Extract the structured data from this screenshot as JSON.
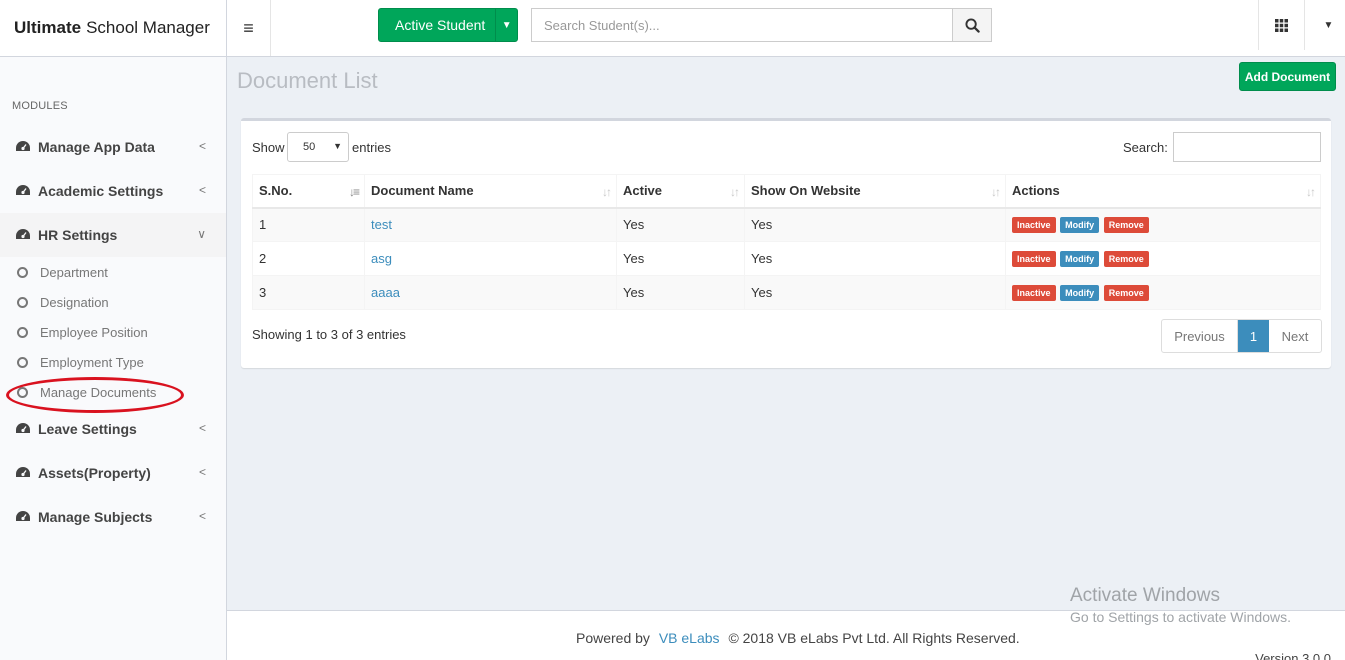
{
  "app": {
    "title_bold": "Ultimate",
    "title_rest": "School Manager"
  },
  "topbar": {
    "active_student_label": "Active Student",
    "search_placeholder": "Search Student(s)..."
  },
  "sidebar": {
    "header": "MODULES",
    "items": [
      {
        "label": "Manage App Data"
      },
      {
        "label": "Academic Settings"
      },
      {
        "label": "HR Settings"
      },
      {
        "label": "Leave Settings"
      },
      {
        "label": "Assets(Property)"
      },
      {
        "label": "Manage Subjects"
      }
    ],
    "hr_subitems": [
      {
        "label": "Department"
      },
      {
        "label": "Designation"
      },
      {
        "label": "Employee Position"
      },
      {
        "label": "Employment Type"
      },
      {
        "label": "Manage Documents"
      }
    ]
  },
  "page": {
    "title": "Document List",
    "add_button": "Add Document"
  },
  "table_controls": {
    "show": "Show",
    "entries": "entries",
    "page_size": "50",
    "search_label": "Search:"
  },
  "table": {
    "columns": [
      "S.No.",
      "Document Name",
      "Active",
      "Show On Website",
      "Actions"
    ],
    "rows": [
      {
        "sno": "1",
        "name": "test",
        "active": "Yes",
        "website": "Yes"
      },
      {
        "sno": "2",
        "name": "asg",
        "active": "Yes",
        "website": "Yes"
      },
      {
        "sno": "3",
        "name": "aaaa",
        "active": "Yes",
        "website": "Yes"
      }
    ],
    "actions": {
      "inactive": "Inactive",
      "modify": "Modify",
      "remove": "Remove"
    }
  },
  "pagination": {
    "info": "Showing 1 to 3 of 3 entries",
    "previous": "Previous",
    "current": "1",
    "next": "Next"
  },
  "footer": {
    "powered_by": "Powered by",
    "company_link": "VB eLabs",
    "copyright": "© 2018 VB eLabs Pvt Ltd. All Rights Reserved.",
    "version": "Version 3.0.0"
  },
  "watermark": {
    "line1": "Activate Windows",
    "line2": "Go to Settings to activate Windows."
  },
  "colors": {
    "primary": "#3c8dbc",
    "success": "#00a65a",
    "danger": "#dd4b39",
    "highlight_oval": "#d9121f"
  }
}
